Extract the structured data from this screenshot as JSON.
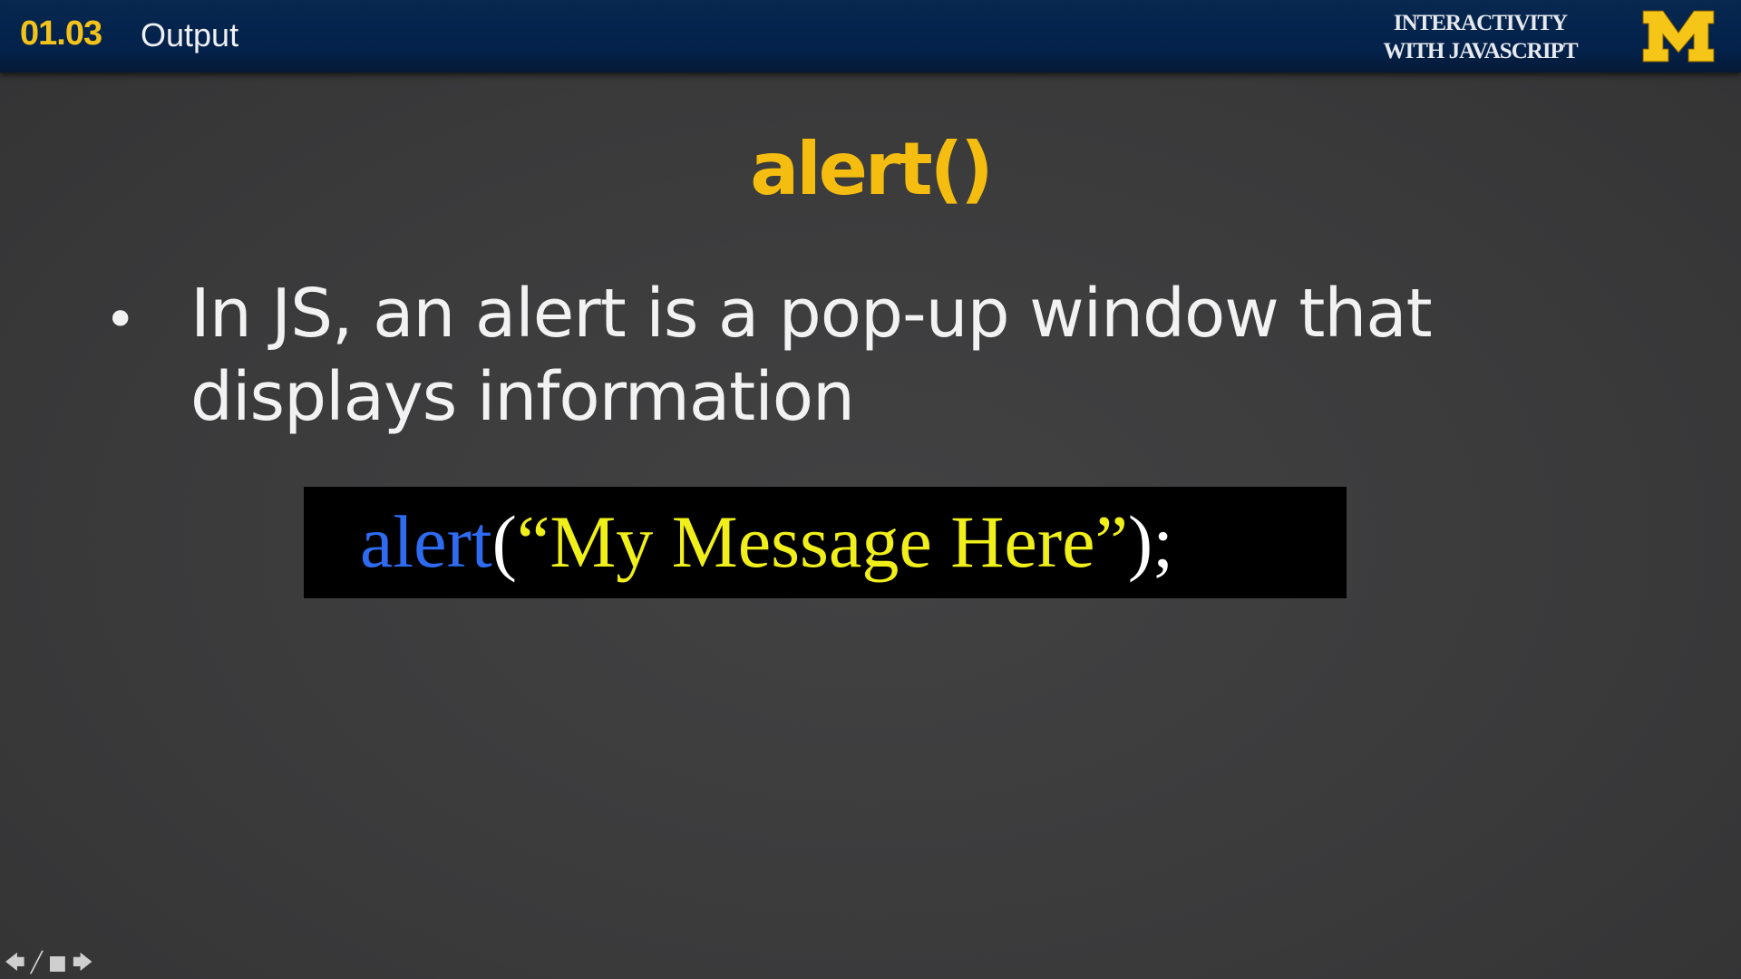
{
  "header": {
    "section_number": "01.03",
    "section_title": "Output",
    "course_title_line1": "INTERACTIVITY",
    "course_title_line2": "WITH JAVASCRIPT",
    "logo_letter": "M",
    "accent": "#f3c21b",
    "bg": "#03214a"
  },
  "slide": {
    "title": "alert()",
    "bullet": "In JS, an alert is a pop-up window that displays information",
    "code": {
      "function": "alert",
      "open": "(",
      "string": "“My Message Here”",
      "close": ");"
    }
  },
  "nav": {
    "icons": [
      "arrow-left-icon",
      "pen-icon",
      "menu-icon",
      "arrow-right-icon"
    ],
    "prev": "🡄",
    "pen": "╱",
    "menu": "■",
    "next": "🡆"
  }
}
